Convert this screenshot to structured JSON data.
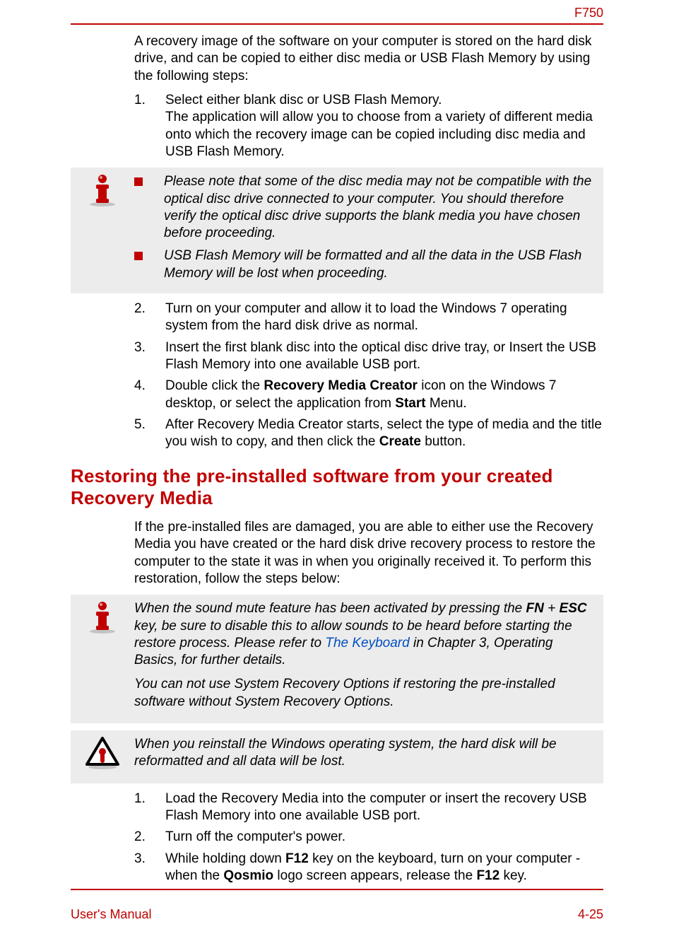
{
  "header": {
    "model": "F750"
  },
  "intro": "A recovery image of the software on your computer is stored on the hard disk drive, and can be copied to either disc media or USB Flash Memory by using the following steps:",
  "steps1": {
    "s1": {
      "num": "1.",
      "text_a": "Select either blank disc or USB Flash Memory.",
      "text_b": "The application will allow you to choose from a variety of different media onto which the recovery image can be copied including disc media and USB Flash Memory."
    }
  },
  "note1": {
    "b1": "Please note that some of the disc media may not be compatible with the optical disc drive connected to your computer. You should therefore verify the optical disc drive supports the blank media you have chosen before proceeding.",
    "b2": "USB Flash Memory will be formatted and all the data in the USB Flash Memory will be lost when proceeding."
  },
  "steps2": {
    "s2": {
      "num": "2.",
      "text": "Turn on your computer and allow it to load the Windows 7 operating system from the hard disk drive as normal."
    },
    "s3": {
      "num": "3.",
      "text": "Insert the first blank disc into the optical disc drive tray, or Insert the USB Flash Memory into one available USB port."
    },
    "s4": {
      "num": "4.",
      "pre": "Double click the ",
      "bold1": "Recovery Media Creator",
      "mid": " icon on the Windows 7 desktop, or select the application from ",
      "bold2": "Start",
      "post": " Menu."
    },
    "s5": {
      "num": "5.",
      "pre": "After Recovery Media Creator starts, select the type of media and the title you wish to copy, and then click the ",
      "bold1": "Create",
      "post": " button."
    }
  },
  "heading2": "Restoring the pre-installed software from your created Recovery Media",
  "para2": "If the pre-installed files are damaged, you are able to either use the Recovery Media you have created or the hard disk drive recovery process to restore the computer to the state it was in when you originally received it. To perform this restoration, follow the steps below:",
  "note2": {
    "p1_pre": "When the sound mute feature has been activated by pressing the ",
    "p1_fn": "FN",
    "p1_plus": " + ",
    "p1_esc": "ESC",
    "p1_mid": " key, be sure to disable this to allow sounds to be heard before starting the restore process. Please refer to ",
    "p1_link": "The Keyboard",
    "p1_post": " in Chapter 3, Operating Basics, for further details.",
    "p2": "You can not use System Recovery Options if restoring the pre-installed software without System Recovery Options."
  },
  "warn": {
    "text": "When you reinstall the Windows operating system, the hard disk will be reformatted and all data will be lost."
  },
  "steps3": {
    "s1": {
      "num": "1.",
      "text": "Load the Recovery Media into the computer or insert the recovery USB Flash Memory into one available USB port."
    },
    "s2": {
      "num": "2.",
      "text": "Turn off the computer's power."
    },
    "s3": {
      "num": "3.",
      "pre": "While holding down ",
      "bold1": "F12",
      "mid": " key on the keyboard, turn on your computer - when the ",
      "bold2": "Qosmio",
      "mid2": " logo screen appears, release the ",
      "bold3": "F12",
      "post": " key."
    }
  },
  "footer": {
    "left": "User's Manual",
    "right": "4-25"
  }
}
